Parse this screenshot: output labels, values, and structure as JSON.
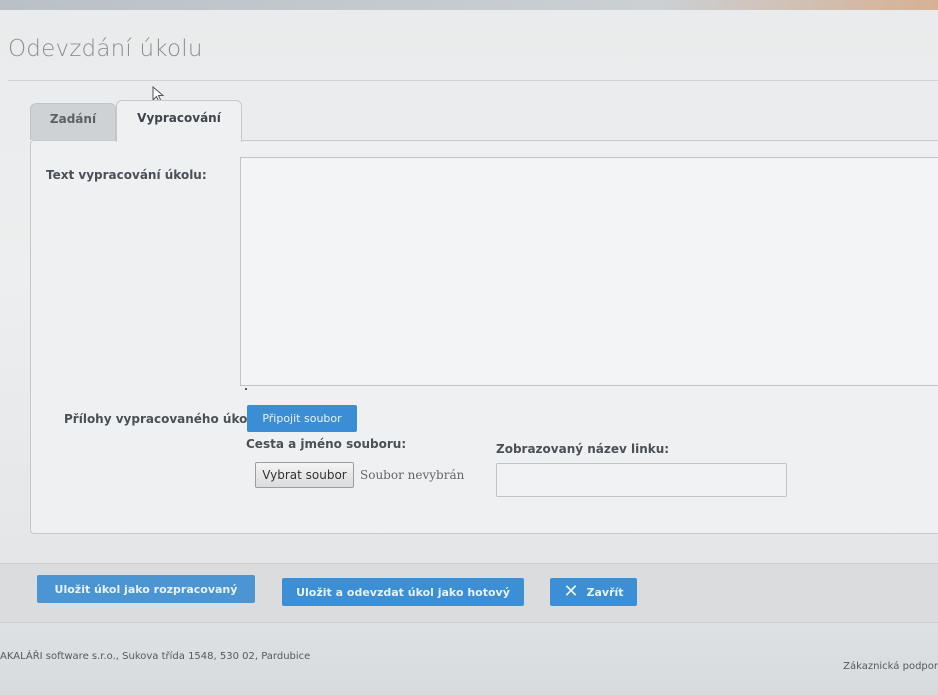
{
  "page": {
    "title": "Odevzdání úkolu"
  },
  "tabs": [
    {
      "label": "Zadání",
      "active": false
    },
    {
      "label": "Vypracování",
      "active": true
    }
  ],
  "form": {
    "text_label": "Text vypracování úkolu:",
    "text_value": "",
    "attachments_label": "Přílohy vypracovaného úkolu:",
    "attach_button": "Připojit soubor",
    "path_label": "Cesta a jméno souboru:",
    "file_button": "Vybrat soubor",
    "file_status": "Soubor nevybrán",
    "link_name_label": "Zobrazovaný název linku:",
    "link_name_value": ""
  },
  "actions": {
    "save_draft": "Uložit úkol jako rozpracovaný",
    "submit": "Uložit a odevzdat úkol jako hotový",
    "close": "Zavřít",
    "close_icon": "✕"
  },
  "footer": {
    "left": "AKALÁŘI software s.r.o., Sukova třída 1548, 530 02, Pardubice",
    "right": "Zákaznická podpor"
  },
  "colors": {
    "primary_button": "#3c8fd4",
    "title": "#8a8f94"
  }
}
